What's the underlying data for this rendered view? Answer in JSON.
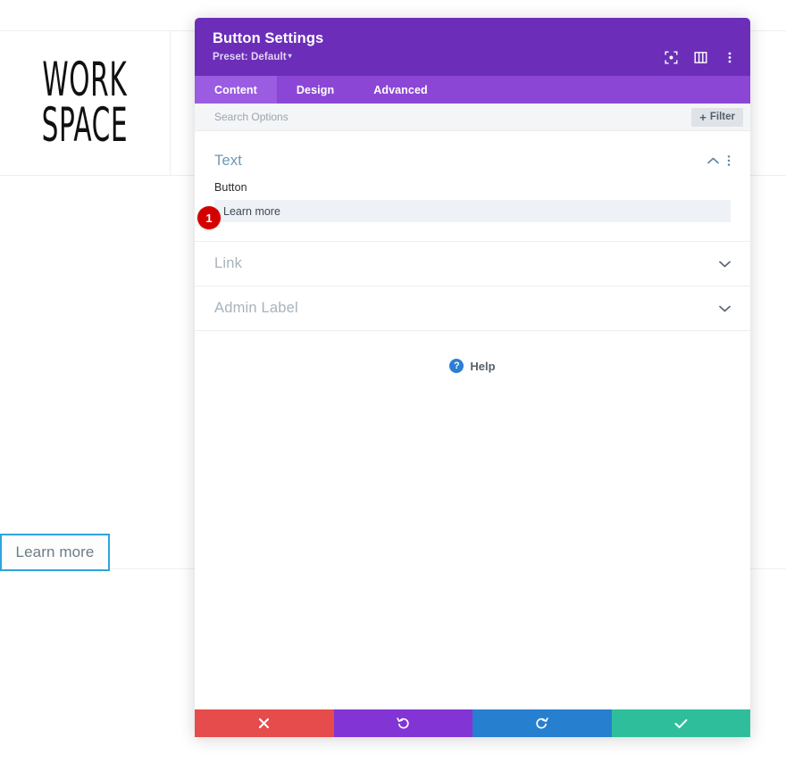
{
  "background": {
    "logo_line1": "WORK",
    "logo_line2": "SPACE",
    "learn_more_button": "Learn more"
  },
  "modal": {
    "title": "Button Settings",
    "preset_label": "Preset: Default",
    "preset_caret": "▾",
    "header_icons": [
      {
        "name": "fullscreen-icon"
      },
      {
        "name": "layout-toggle-icon"
      },
      {
        "name": "overflow-menu-icon"
      }
    ],
    "tabs": [
      {
        "label": "Content",
        "active": true
      },
      {
        "label": "Design",
        "active": false
      },
      {
        "label": "Advanced",
        "active": false
      }
    ],
    "search": {
      "placeholder": "Search Options",
      "value": ""
    },
    "filter_button": {
      "plus": "+",
      "label": "Filter"
    },
    "sections": [
      {
        "title": "Text",
        "state": "expanded",
        "field_label": "Button",
        "field_value": "Learn more",
        "badge": "1"
      },
      {
        "title": "Link",
        "state": "collapsed"
      },
      {
        "title": "Admin Label",
        "state": "collapsed"
      }
    ],
    "help": {
      "icon_glyph": "?",
      "label": "Help"
    },
    "footer_buttons": [
      {
        "name": "cancel-button",
        "icon": "close-icon",
        "color": "#e64c4c"
      },
      {
        "name": "undo-button",
        "icon": "undo-icon",
        "color": "#8334d4"
      },
      {
        "name": "redo-button",
        "icon": "redo-icon",
        "color": "#2680cf"
      },
      {
        "name": "save-button",
        "icon": "check-icon",
        "color": "#2fbe9b"
      }
    ]
  },
  "colors": {
    "header_purple": "#6c2eb9",
    "tabbar_purple": "#8b46d6",
    "tab_active_purple": "#9a5ce0",
    "badge_red": "#d40000",
    "help_blue": "#2a7fd4",
    "section_title_blue": "#6d98b5",
    "accent_button_blue": "#2ea3dd"
  }
}
